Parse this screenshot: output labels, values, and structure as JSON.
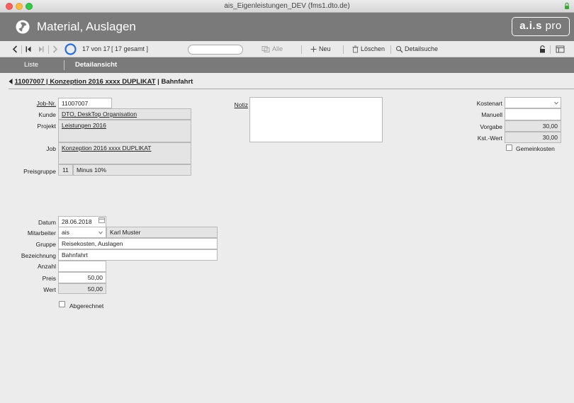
{
  "window": {
    "title": "ais_Eigenleistungen_DEV (fms1.dto.de)"
  },
  "header": {
    "title": "Material, Auslagen",
    "brand_main": "a.i.s",
    "brand_sub": "pro"
  },
  "toolbar": {
    "record_position": "17 von 17",
    "record_total": "[ 17 gesamt ]",
    "all_label": "Alle",
    "new_label": "Neu",
    "delete_label": "Löschen",
    "detail_search_label": "Detailsuche"
  },
  "tabs": [
    {
      "label": "Liste"
    },
    {
      "label": "Detailansicht"
    }
  ],
  "breadcrumb": {
    "link": "11007007 | Konzeption 2016 xxxx DUPLIKAT",
    "suffix": " | Bahnfahrt"
  },
  "job_section": {
    "job_nr_label": "Job-Nr.",
    "job_nr": "11007007",
    "kunde_label": "Kunde",
    "kunde": "DTO, DeskTop Organisation",
    "projekt_label": "Projekt",
    "projekt": "Leistungen 2016",
    "job_label": "Job",
    "job": "Konzeption 2016 xxxx DUPLIKAT",
    "preisgruppe_label": "Preisgruppe",
    "preisgruppe_nr": "11",
    "preisgruppe": "Minus 10%"
  },
  "notiz": {
    "label": "Notiz",
    "value": ""
  },
  "cost_section": {
    "kostenart_label": "Kostenart",
    "kostenart": "",
    "manuell_label": "Manuell",
    "manuell": "",
    "vorgabe_label": "Vorgabe",
    "vorgabe": "30,00",
    "kst_wert_label": "Kst.-Wert",
    "kst_wert": "30,00",
    "gemeinkosten_label": "Gemeinkosten"
  },
  "entry": {
    "datum_label": "Datum",
    "datum": "28.06.2018",
    "mitarbeiter_label": "Mitarbeiter",
    "mitarbeiter_code": "ais",
    "mitarbeiter_name": "Karl Muster",
    "gruppe_label": "Gruppe",
    "gruppe": "Reisekosten, Auslagen",
    "bezeichnung_label": "Bezeichnung",
    "bezeichnung": "Bahnfahrt",
    "anzahl_label": "Anzahl",
    "anzahl": "",
    "preis_label": "Preis",
    "preis": "50,00",
    "wert_label": "Wert",
    "wert": "50,00",
    "abgerechnet_label": "Abgerechnet"
  },
  "colors": {
    "header_bg": "#7a7a7a",
    "accent_blue": "#2a6fd8",
    "lock_green": "#3aa83a"
  }
}
